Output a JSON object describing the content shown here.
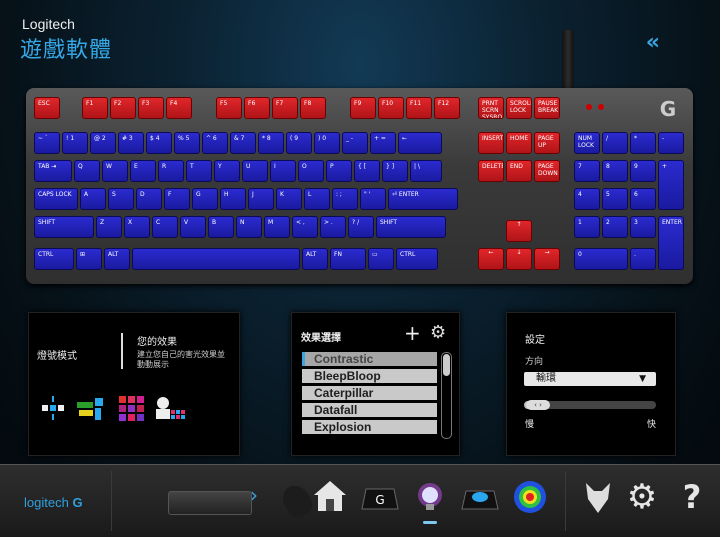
{
  "header": {
    "brand": "Logitech",
    "title": "遊戲軟體",
    "collapse_glyph": "«"
  },
  "keyboard": {
    "row_fn": [
      "ESC",
      "F1",
      "F2",
      "F3",
      "F4",
      "F5",
      "F6",
      "F7",
      "F8",
      "F9",
      "F10",
      "F11",
      "F12",
      "PRNT SCRN SYSRQ",
      "SCROLL LOCK",
      "PAUSE BREAK"
    ],
    "row_num": [
      "~ `",
      "! 1",
      "@ 2",
      "# 3",
      "$ 4",
      "% 5",
      "^ 6",
      "& 7",
      "* 8",
      "( 9",
      ") 0",
      "_ -",
      "+ =",
      "←"
    ],
    "row_tab": [
      "TAB ⇥",
      "Q",
      "W",
      "E",
      "R",
      "T",
      "Y",
      "U",
      "I",
      "O",
      "P",
      "{ [",
      "} ]",
      "| \\"
    ],
    "row_caps": [
      "CAPS LOCK",
      "A",
      "S",
      "D",
      "F",
      "G",
      "H",
      "J",
      "K",
      "L",
      ": ;",
      "\" '",
      "⏎ ENTER"
    ],
    "row_shift": [
      "SHIFT",
      "Z",
      "X",
      "C",
      "V",
      "B",
      "N",
      "M",
      "< ,",
      "> .",
      "? /",
      "SHIFT"
    ],
    "row_ctrl": [
      "CTRL",
      "⊞",
      "ALT",
      "",
      "ALT",
      "FN",
      "▭",
      "CTRL"
    ],
    "nav": [
      "INSERT",
      "HOME",
      "PAGE UP",
      "DELETE",
      "END",
      "PAGE DOWN",
      "↑",
      "←",
      "↓",
      "→"
    ],
    "numpad": [
      "NUM LOCK",
      "/",
      "*",
      "-",
      "7",
      "8",
      "9",
      "+",
      "4",
      "5",
      "6",
      "1",
      "2",
      "3",
      "ENTER",
      "0",
      "."
    ]
  },
  "panel_lighting": {
    "mode_label": "燈號模式",
    "effect_title": "您的效果",
    "effect_desc": "建立您自己的害光效果並動動展示"
  },
  "panel_effects": {
    "title": "效果選擇",
    "add_glyph": "+",
    "items": [
      "Contrastic",
      "BleepBloop",
      "Caterpillar",
      "Datafall",
      "Explosion"
    ]
  },
  "panel_settings": {
    "title": "設定",
    "direction_label": "方向",
    "direction_value": "輸環",
    "speed_value": 0.15,
    "speed_handle": "‹ ›",
    "slow_label": "慢",
    "fast_label": "快"
  },
  "bottom": {
    "brand": "logitech"
  },
  "colors": {
    "red_key": "#d01c20",
    "blue_key": "#2020c0",
    "accent": "#3aa3e0"
  }
}
